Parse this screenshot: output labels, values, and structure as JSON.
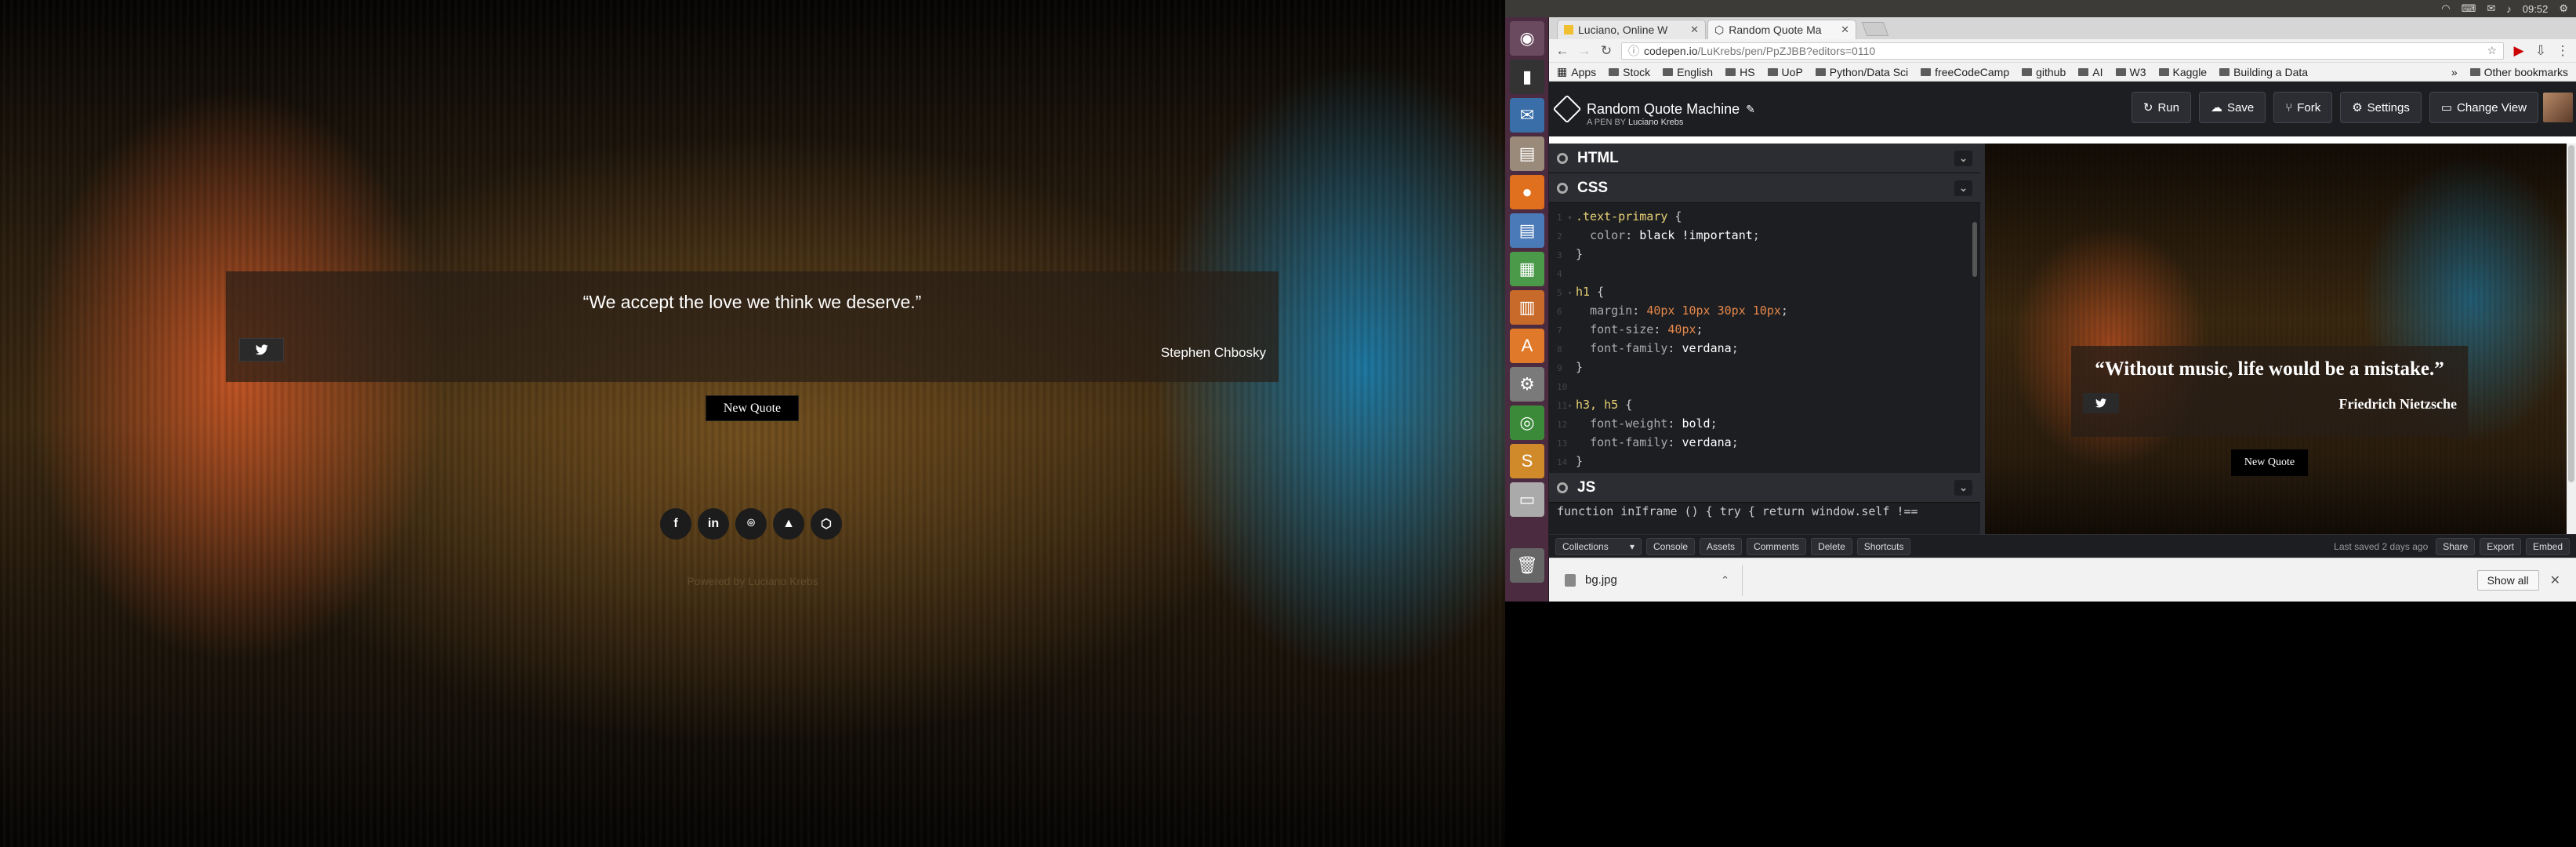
{
  "left_page": {
    "quote": "“We accept the love we think we deserve.”",
    "author": "Stephen Chbosky",
    "new_quote_label": "New Quote",
    "social_icons": [
      "facebook-icon",
      "linkedin-icon",
      "github-icon",
      "freecodecamp-icon",
      "codepen-icon"
    ],
    "social_glyphs": [
      "f",
      "in",
      "⌾",
      "▲",
      "⬡"
    ],
    "powered_by": "Powered by Luciano Krebs"
  },
  "topbar": {
    "time": "09:52"
  },
  "browser": {
    "tabs": [
      {
        "label": "Luciano, Online W",
        "active": false
      },
      {
        "label": "Random Quote Ma",
        "active": true
      }
    ],
    "url_host": "codepen.io",
    "url_path": "/LuKrebs/pen/PpZJBB?editors=0110",
    "bookmarks": [
      "Apps",
      "Stock",
      "English",
      "HS",
      "UoP",
      "Python/Data Sci",
      "freeCodeCamp",
      "github",
      "AI",
      "W3",
      "Kaggle",
      "Building a Data"
    ],
    "other_bookmarks": "Other bookmarks"
  },
  "codepen": {
    "title": "Random Quote Machine",
    "subtitle_prefix": "A PEN BY",
    "author": "Luciano Krebs",
    "buttons": {
      "run": "Run",
      "save": "Save",
      "fork": "Fork",
      "settings": "Settings",
      "change_view": "Change View"
    },
    "editors": {
      "html": "HTML",
      "css": "CSS",
      "js": "JS"
    },
    "js_line": "function inIframe () { try { return window.self !==",
    "footer": {
      "collections": "Collections",
      "console": "Console",
      "assets": "Assets",
      "comments": "Comments",
      "delete": "Delete",
      "shortcuts": "Shortcuts",
      "saved": "Last saved 2 days ago",
      "share": "Share",
      "export": "Export",
      "embed": "Embed"
    },
    "preview": {
      "quote": "“Without music, life would be a mistake.”",
      "author": "Friedrich Nietzsche",
      "new_quote_label": "New Quote"
    }
  },
  "downloads": {
    "file": "bg.jpg",
    "show_all": "Show all"
  },
  "colors": {
    "codepen_bg": "#1d1e22",
    "launcher": "#4a2b3f",
    "selector": "#e6d074",
    "number": "#e6884a"
  }
}
